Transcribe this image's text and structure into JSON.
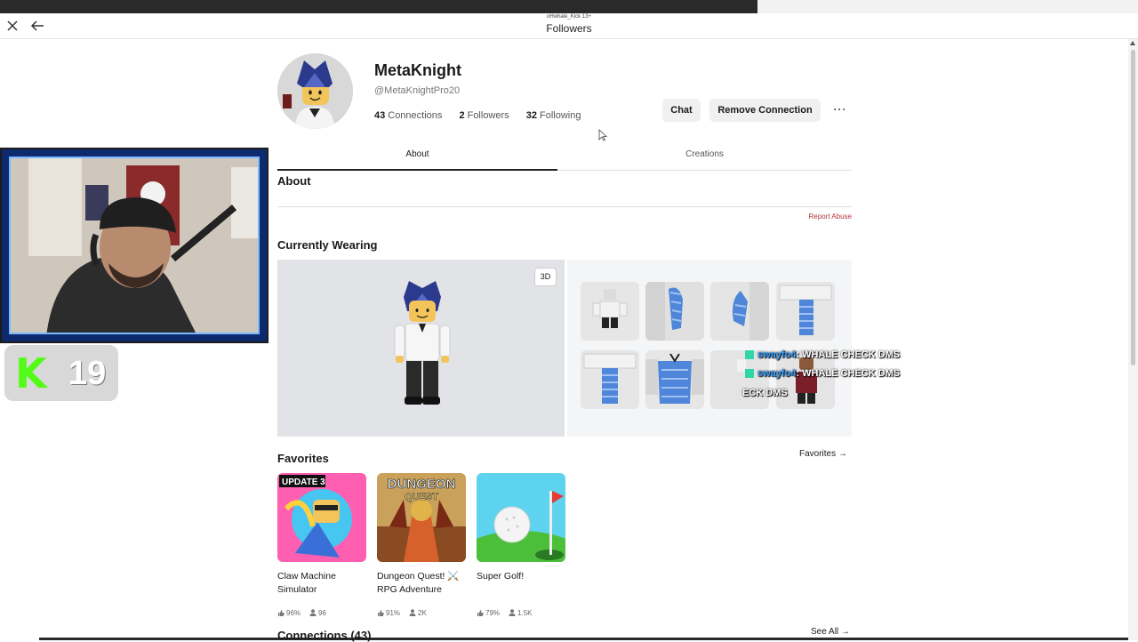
{
  "window": {
    "small_title": "oHwhale_Kick 13+",
    "title": "Followers"
  },
  "profile": {
    "display_name": "MetaKnight",
    "username": "@MetaKnightPro20",
    "connections_count": "43",
    "connections_label": "Connections",
    "followers_count": "2",
    "followers_label": "Followers",
    "following_count": "32",
    "following_label": "Following",
    "chat_label": "Chat",
    "remove_label": "Remove Connection",
    "more_label": "···"
  },
  "tabs": [
    {
      "label": "About",
      "active": true
    },
    {
      "label": "Creations",
      "active": false
    }
  ],
  "about": {
    "heading": "About",
    "report_label": "Report Abuse"
  },
  "wearing": {
    "heading": "Currently Wearing",
    "view_3d_label": "3D"
  },
  "stream_chat": [
    {
      "user": "swayfo4",
      "message": ": WHALE CHECK DMS"
    },
    {
      "user": "swayfo4",
      "message": ": WHALE CHECK DMS"
    },
    {
      "user": "",
      "message": "ECK DMS"
    }
  ],
  "favorites": {
    "heading": "Favorites",
    "link_label": "Favorites →",
    "games": [
      {
        "name": "Claw Machine Simulator",
        "rating": "96%",
        "players": "96"
      },
      {
        "name": "Dungeon Quest! ⚔️ RPG Adventure",
        "rating": "91%",
        "players": "2K"
      },
      {
        "name": "Super Golf!",
        "rating": "79%",
        "players": "1.5K"
      }
    ]
  },
  "connections": {
    "heading": "Connections (43)",
    "see_all_label": "See All →"
  },
  "overlay": {
    "kick_logo": "K",
    "kick_count": "19"
  },
  "thumb_text": {
    "update": "UPDATE 3",
    "dungeon": "DUNGEON",
    "quest": "QUEST"
  }
}
